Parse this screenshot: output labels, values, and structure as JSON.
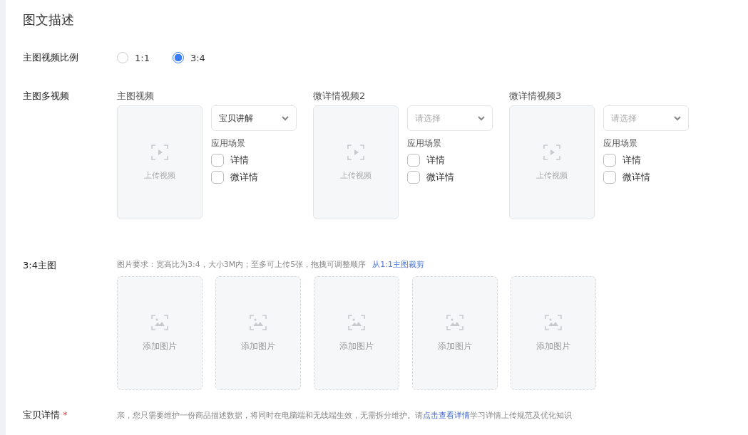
{
  "title": "图文描述",
  "ratio": {
    "label": "主图视频比例",
    "options": [
      {
        "label": "1:1",
        "selected": false
      },
      {
        "label": "3:4",
        "selected": true
      }
    ]
  },
  "multi_video": {
    "label": "主图多视频",
    "slots": [
      {
        "title": "主图视频",
        "upload": "上传视频",
        "select": {
          "value": "宝贝讲解"
        },
        "scene_label": "应用场景",
        "scenes": [
          {
            "label": "详情",
            "checked": false
          },
          {
            "label": "微详情",
            "checked": false
          }
        ]
      },
      {
        "title": "微详情视频2",
        "upload": "上传视频",
        "select": {
          "placeholder": "请选择"
        },
        "scene_label": "应用场景",
        "scenes": [
          {
            "label": "详情",
            "checked": false
          },
          {
            "label": "微详情",
            "checked": false
          }
        ]
      },
      {
        "title": "微详情视频3",
        "upload": "上传视频",
        "select": {
          "placeholder": "请选择"
        },
        "scene_label": "应用场景",
        "scenes": [
          {
            "label": "详情",
            "checked": false
          },
          {
            "label": "微详情",
            "checked": false
          }
        ]
      }
    ]
  },
  "main_images": {
    "label": "3:4主图",
    "hint": "图片要求：宽高比为3:4，大小3M内；至多可上传5张，拖拽可调整顺序",
    "link": "从1:1主图裁剪",
    "slots": [
      "添加图片",
      "添加图片",
      "添加图片",
      "添加图片",
      "添加图片"
    ]
  },
  "detail": {
    "label": "宝贝详情",
    "required_mark": "*",
    "note_before": "亲，您只需要维护一份商品描述数据，将同时在电脑端和无线端生效，无需拆分维护。请",
    "note_link": "点击查看详情",
    "note_after": "学习详情上传规范及优化知识"
  }
}
